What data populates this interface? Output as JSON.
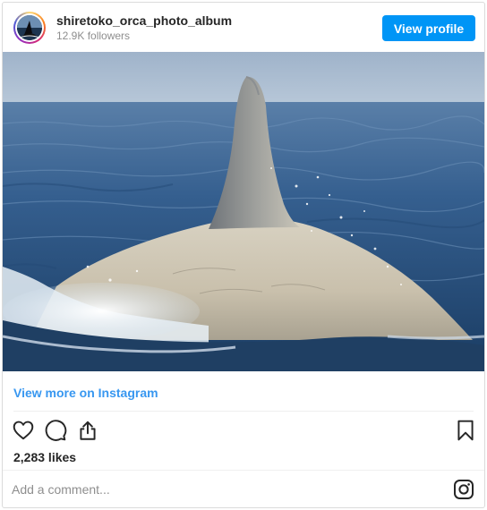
{
  "header": {
    "username": "shiretoko_orca_photo_album",
    "followers": "12.9K followers",
    "view_profile_label": "View profile",
    "avatar_icon": "orca-avatar"
  },
  "post": {
    "image_subject": "white orca dorsal fin surfacing in the sea",
    "view_more_label": "View more on Instagram",
    "likes": "2,283 likes"
  },
  "actions": {
    "icons": [
      "heart-icon",
      "comment-icon",
      "share-icon",
      "bookmark-icon"
    ]
  },
  "comment": {
    "placeholder": "Add a comment..."
  },
  "colors": {
    "accent": "#0095f6",
    "link": "#3897f0",
    "text": "#262626",
    "muted": "#8e8e8e",
    "border": "#dbdbdb"
  }
}
